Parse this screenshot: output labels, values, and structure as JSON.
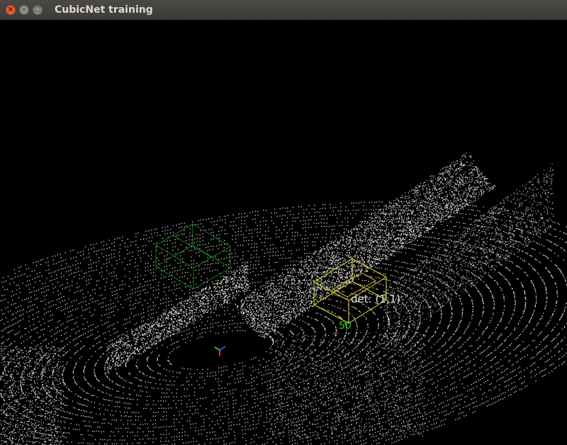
{
  "window": {
    "title": "CubicNet training",
    "buttons": {
      "close_icon": "×",
      "minimize_icon": "–",
      "maximize_icon": "□"
    }
  },
  "viewport": {
    "background": "#000000",
    "point_color": "#ffffff",
    "detection_label": "det: (1,1)",
    "score_label": "50",
    "detection_box_color": "#e6e01a",
    "ground_truth_box_color": "#1c7a1c",
    "score_color": "#22cc22"
  }
}
